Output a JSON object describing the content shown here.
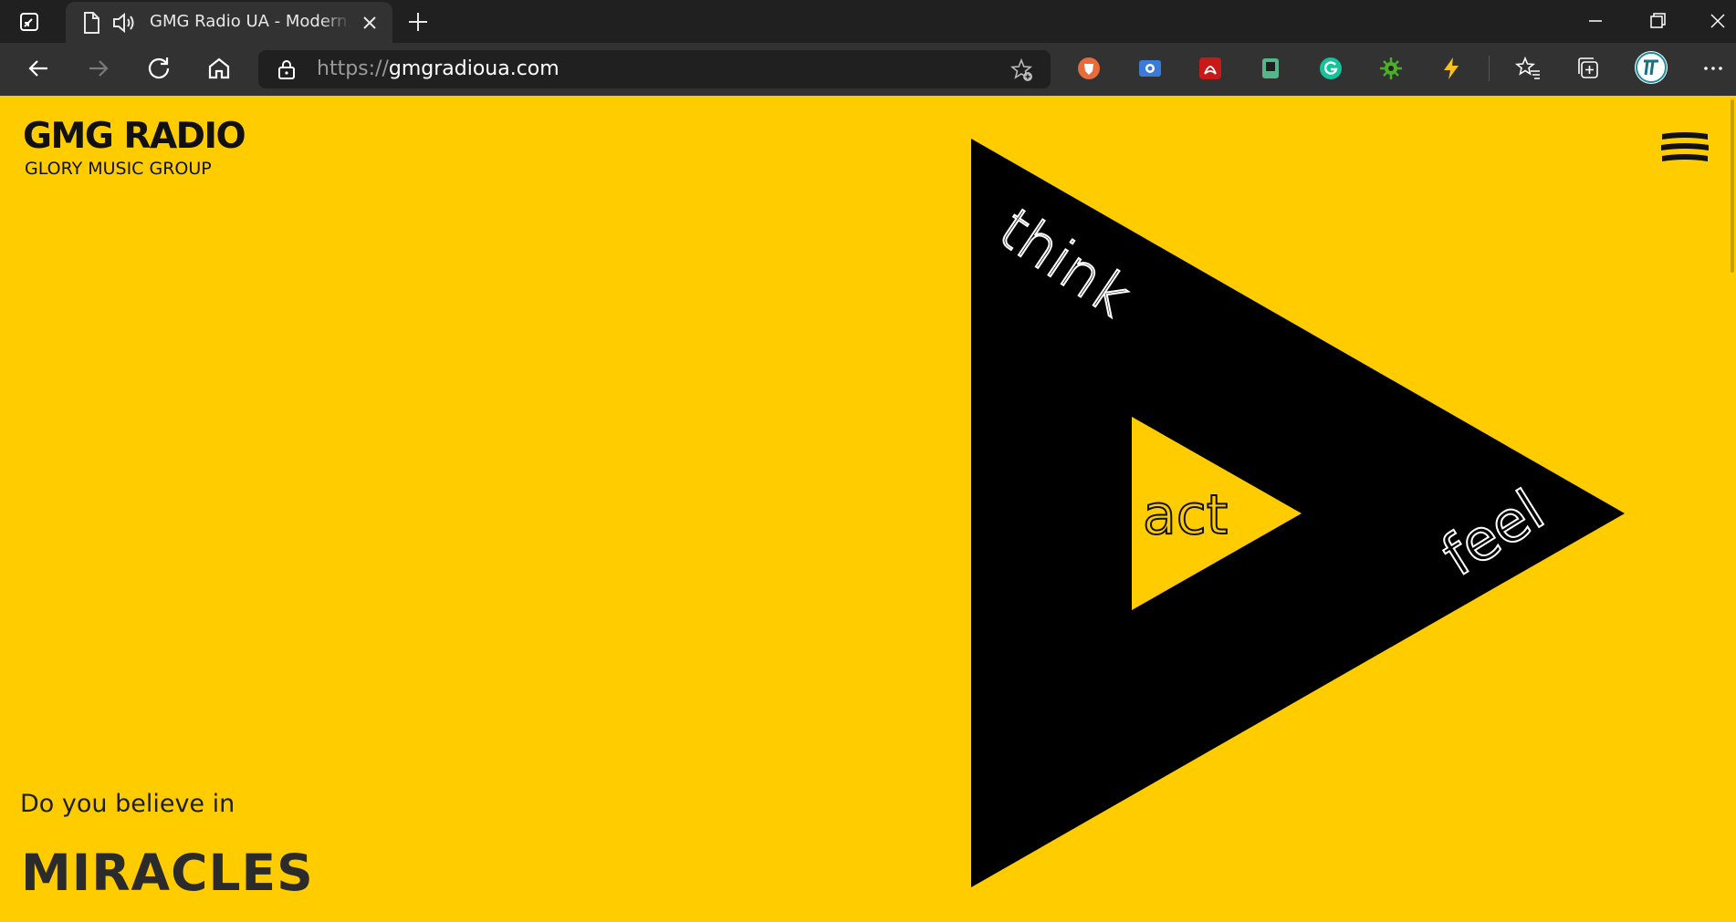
{
  "browser": {
    "tab": {
      "title": "GMG Radio UA - Modern, powerful and inspiring"
    },
    "address": {
      "scheme": "https://",
      "host": "gmgradioua.com"
    },
    "icons": {
      "tab_actions": "tab-actions-icon",
      "page": "page-icon",
      "audio": "speaker-icon",
      "close": "close-icon",
      "new_tab": "plus-icon",
      "back": "back-arrow-icon",
      "forward": "forward-arrow-icon",
      "refresh": "refresh-icon",
      "home": "home-icon",
      "lock": "lock-icon",
      "favorite": "add-favorite-icon",
      "favorites": "favorites-icon",
      "collections": "collections-icon",
      "more": "more-icon"
    },
    "extensions": [
      "brave-shield",
      "screen-capture",
      "pdf",
      "tab-manager",
      "grammarly",
      "bug-checker",
      "lightning"
    ],
    "colors": {
      "frame": "#202020",
      "toolbar": "#323232",
      "text": "#e8e8e8"
    }
  },
  "site": {
    "logo": {
      "title": "GMG RADIO",
      "subtitle": "GLORY MUSIC GROUP"
    },
    "menu_icon": "hamburger-menu-icon",
    "hero": {
      "words": [
        "think",
        "act",
        "feel"
      ]
    },
    "tagline": {
      "intro": "Do you believe in",
      "headline": "MIRACLES"
    },
    "colors": {
      "background": "#ffcc00",
      "triangle": "#000000",
      "word_outer": "#ffffff",
      "word_inner": "#111111"
    }
  }
}
